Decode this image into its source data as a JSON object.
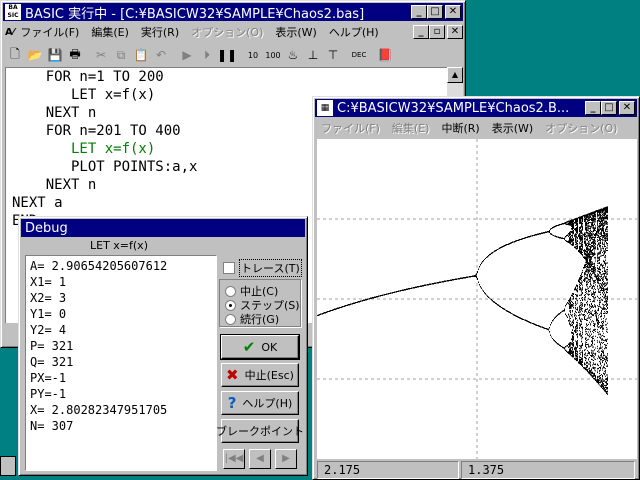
{
  "main_window": {
    "title": "BASIC 実行中 - [C:¥BASICW32¥SAMPLE¥Chaos2.bas]",
    "menu": [
      {
        "label": "ファイル(F)",
        "enabled": true
      },
      {
        "label": "編集(E)",
        "enabled": true
      },
      {
        "label": "実行(R)",
        "enabled": true
      },
      {
        "label": "オプション(O)",
        "enabled": false
      },
      {
        "label": "表示(W)",
        "enabled": true
      },
      {
        "label": "ヘルプ(H)",
        "enabled": true
      }
    ],
    "code_lines": [
      {
        "text": "    FOR n=1 TO 200",
        "highlight": false
      },
      {
        "text": "       LET x=f(x)",
        "highlight": false
      },
      {
        "text": "    NEXT n",
        "highlight": false
      },
      {
        "text": "    FOR n=201 TO 400",
        "highlight": false
      },
      {
        "text": "       LET x=f(x)",
        "highlight": true
      },
      {
        "text": "       PLOT POINTS:a,x",
        "highlight": false
      },
      {
        "text": "    NEXT n",
        "highlight": false
      },
      {
        "text": "NEXT a",
        "highlight": false
      },
      {
        "text": "END",
        "highlight": false
      }
    ]
  },
  "plot_window": {
    "title": "C:¥BASICW32¥SAMPLE¥Chaos2.B...",
    "menu": [
      {
        "label": "ファイル(F)",
        "enabled": false
      },
      {
        "label": "編集(E)",
        "enabled": false
      },
      {
        "label": "中断(R)",
        "enabled": true
      },
      {
        "label": "表示(W)",
        "enabled": true
      },
      {
        "label": "オプション(O)",
        "enabled": false
      }
    ],
    "status": {
      "x": "2.175",
      "y": "1.375"
    }
  },
  "debug_window": {
    "title": "Debug",
    "current_statement": "LET x=f(x)",
    "variables": [
      "A= 2.90654205607612",
      "X1= 1",
      "X2= 3",
      "Y1= 0",
      "Y2= 4",
      "P= 321",
      "Q= 321",
      "PX=-1",
      "PY=-1",
      "X= 2.80282347951705",
      "N= 307"
    ],
    "trace_label": "トレース(T)",
    "trace_checked": false,
    "modes": [
      {
        "label": "中止(C)",
        "selected": false
      },
      {
        "label": "ステップ(S)",
        "selected": true
      },
      {
        "label": "続行(G)",
        "selected": false
      }
    ],
    "ok_label": "OK",
    "stop_label": "中止(Esc)",
    "help_label": "ヘルプ(H)",
    "breakpoint_label": "ブレークポイント"
  },
  "colors": {
    "titlebar_active": "#000080",
    "desktop": "#008080",
    "highlight_code": "#008000"
  }
}
